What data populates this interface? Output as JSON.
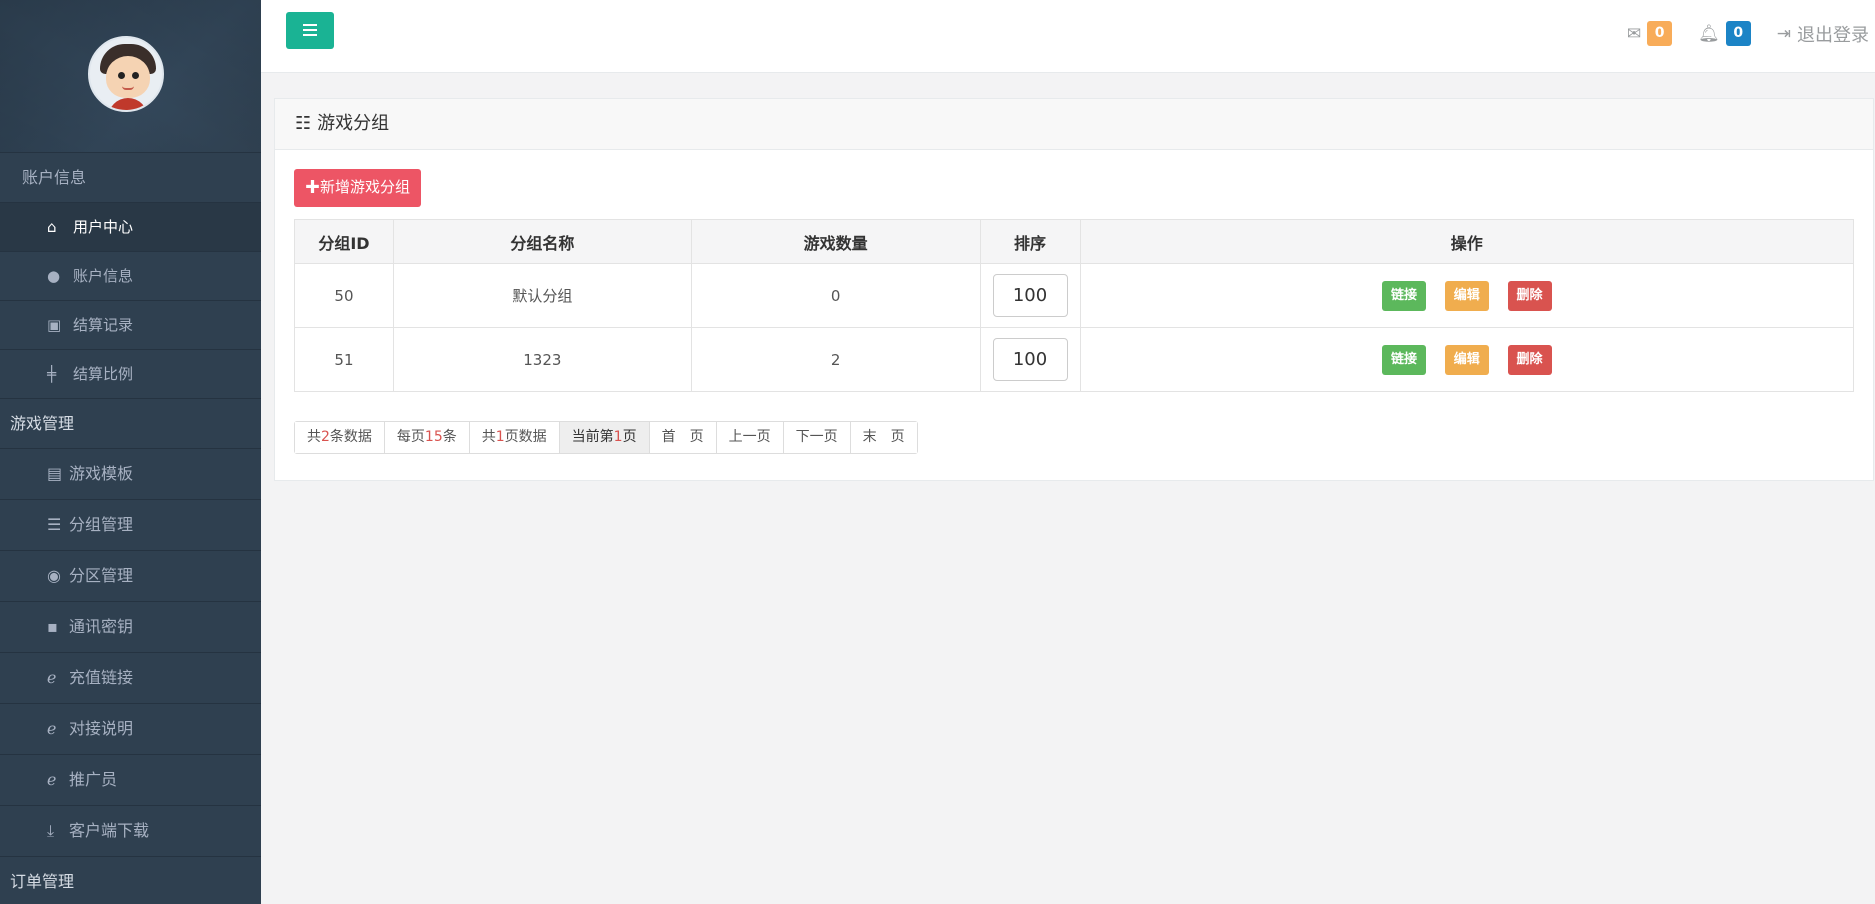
{
  "sidebar": {
    "section_account": "账户信息",
    "items_account": [
      {
        "label": "用户中心",
        "icon": "home-icon",
        "active": true
      },
      {
        "label": "账户信息",
        "icon": "user-icon"
      },
      {
        "label": "结算记录",
        "icon": "calendar-check-icon"
      },
      {
        "label": "结算比例",
        "icon": "signpost-icon"
      }
    ],
    "section_game": "游戏管理",
    "items_game": [
      {
        "label": "游戏模板",
        "icon": "newspaper-icon"
      },
      {
        "label": "分组管理",
        "icon": "bars-icon"
      },
      {
        "label": "分区管理",
        "icon": "gamepad-icon"
      },
      {
        "label": "通讯密钥",
        "icon": "lock-icon"
      },
      {
        "label": "充值链接",
        "icon": "ie-icon"
      },
      {
        "label": "对接说明",
        "icon": "ie-icon"
      },
      {
        "label": "推广员",
        "icon": "ie-icon"
      },
      {
        "label": "客户端下载",
        "icon": "download-icon"
      }
    ],
    "section_order": "订单管理"
  },
  "topbar": {
    "mail_count": "0",
    "bell_count": "0",
    "logout_label": "退出登录"
  },
  "panel": {
    "title": "游戏分组",
    "add_button": "✚新增游戏分组",
    "columns": [
      "分组ID",
      "分组名称",
      "游戏数量",
      "排序",
      "操作"
    ],
    "rows": [
      {
        "id": "50",
        "name": "默认分组",
        "count": "0",
        "sort": "100"
      },
      {
        "id": "51",
        "name": "1323",
        "count": "2",
        "sort": "100"
      }
    ],
    "actions": {
      "link": "链接",
      "edit": "编辑",
      "delete": "删除"
    }
  },
  "pager": {
    "total_pre": "共",
    "total_num": "2",
    "total_post": "条数据",
    "per_pre": "每页",
    "per_num": "15",
    "per_post": "条",
    "pages_pre": "共",
    "pages_num": "1",
    "pages_post": "页数据",
    "cur_pre": "当前第",
    "cur_num": "1",
    "cur_post": "页",
    "first": "首　页",
    "prev": "上一页",
    "next": "下一页",
    "last": "末　页"
  },
  "colors": {
    "sidebar_bg": "#2f4050",
    "menu_button": "#1ab394",
    "add_button": "#ed5565",
    "badge_mail": "#f8ac59",
    "badge_bell": "#1c84c6",
    "link_button": "#5cb85c",
    "edit_button": "#f0ad4e",
    "delete_button": "#d9534f"
  }
}
